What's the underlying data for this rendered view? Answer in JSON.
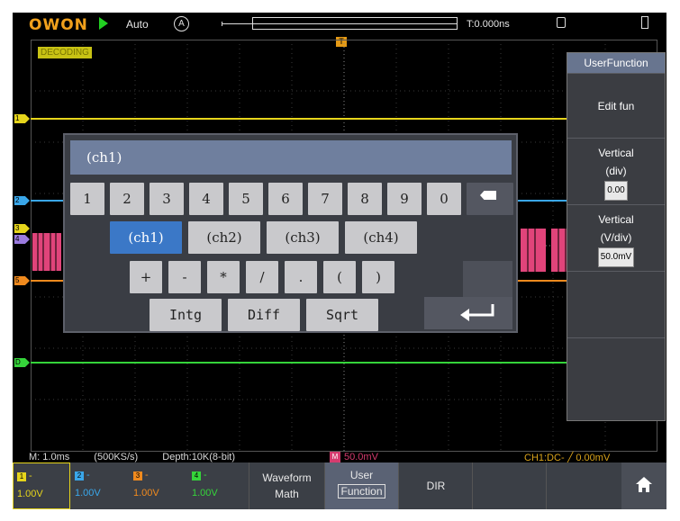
{
  "topbar": {
    "logo": "OWON",
    "mode": "Auto",
    "trigger_source_letter": "A",
    "trigger_time": "T:0.000ns",
    "trigger_pos_marker": "T"
  },
  "decoding_label": "DECODING",
  "channel_markers": [
    "1",
    "2",
    "3",
    "4",
    "5",
    "D"
  ],
  "keyboard": {
    "expression": "(ch1)",
    "digits": [
      "1",
      "2",
      "3",
      "4",
      "5",
      "6",
      "7",
      "8",
      "9",
      "0"
    ],
    "channels": [
      "(ch1)",
      "(ch2)",
      "(ch3)",
      "(ch4)"
    ],
    "selected_channel": "(ch1)",
    "operators": [
      "+",
      "-",
      "*",
      "/",
      ".",
      "(",
      ")"
    ],
    "functions": [
      "Intg",
      "Diff",
      "Sqrt"
    ]
  },
  "menu": {
    "title": "UserFunction",
    "edit": "Edit fun",
    "vertical_div_label1": "Vertical",
    "vertical_div_label2": "(div)",
    "vertical_div_value": "0.00",
    "vertical_vdiv_label1": "Vertical",
    "vertical_vdiv_label2": "(V/div)",
    "vertical_vdiv_value": "50.0mV"
  },
  "status": {
    "timebase": "M: 1.0ms",
    "sample_rate": "(500KS/s)",
    "depth": "Depth:10K(8-bit)",
    "math_badge": "M",
    "math_value": "50.0mV",
    "trigger": "CH1:DC-",
    "trigger_level": "0.00mV"
  },
  "bottom": {
    "channels": [
      {
        "num": "1",
        "dash": "-",
        "volts": "1.00V",
        "color": "#e6d51b"
      },
      {
        "num": "2",
        "dash": "-",
        "volts": "1.00V",
        "color": "#3aa7ea"
      },
      {
        "num": "3",
        "dash": "-",
        "volts": "1.00V",
        "color": "#f08a1e"
      },
      {
        "num": "4",
        "dash": "-",
        "volts": "1.00V",
        "color": "#35d43a"
      }
    ],
    "softkeys": {
      "waveform_math1": "Waveform",
      "waveform_math2": "Math",
      "user_function1": "User",
      "user_function2": "Function",
      "dir": "DIR"
    },
    "home_icon": "home-icon"
  },
  "colors": {
    "ch1": "#e6d51b",
    "ch2": "#3aa7ea",
    "ch3": "#f08a1e",
    "ch4": "#35d43a",
    "math": "#d53b6e",
    "accent": "#3b78c7"
  }
}
